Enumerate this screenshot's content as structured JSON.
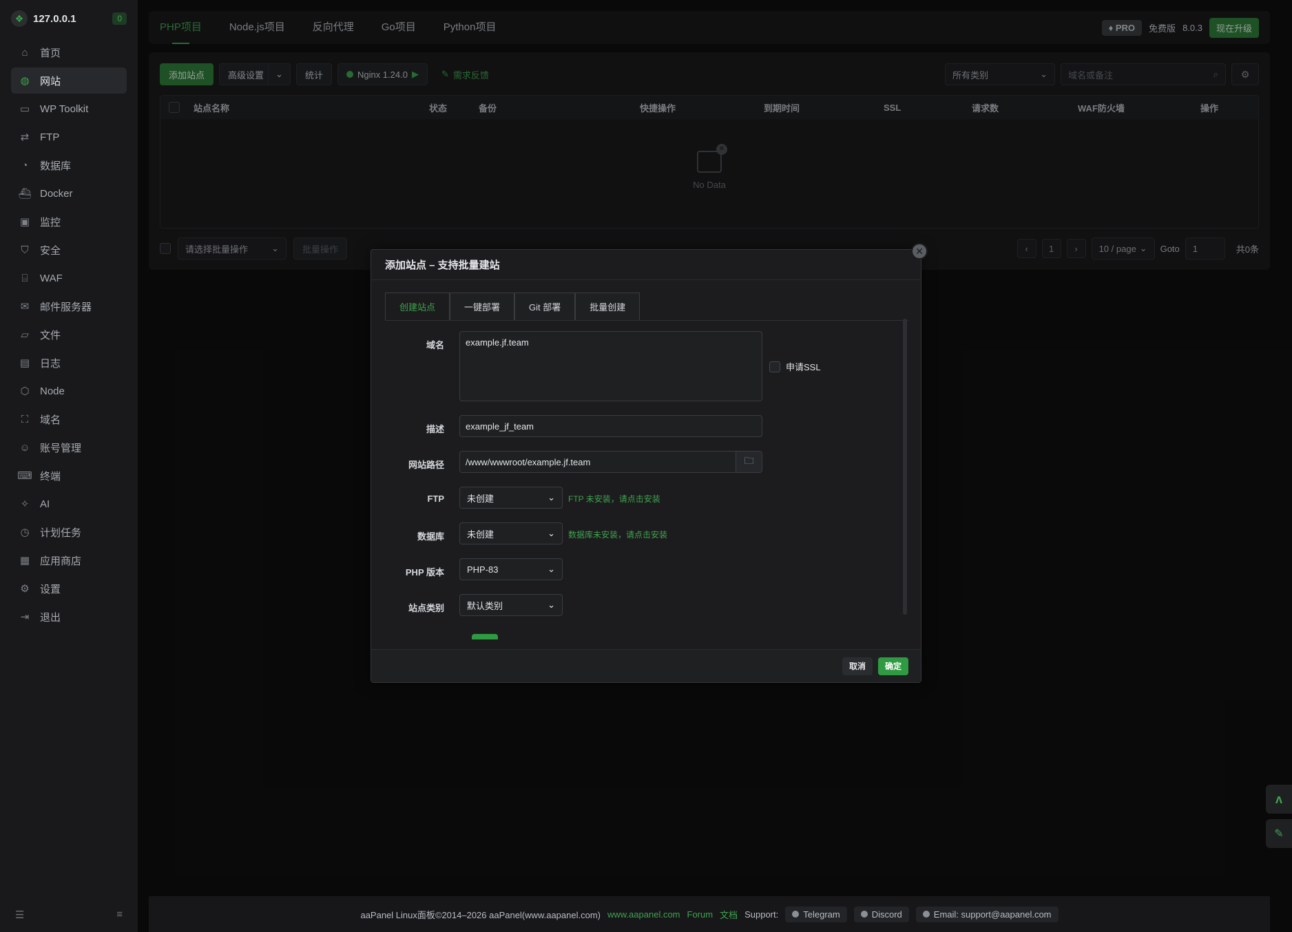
{
  "sidebar": {
    "host": "127.0.0.1",
    "badge": "0",
    "items": [
      {
        "label": "首页",
        "icon": "home-icon",
        "glyph": "⌂"
      },
      {
        "label": "网站",
        "icon": "globe-icon",
        "glyph": "◍"
      },
      {
        "label": "WP Toolkit",
        "icon": "wordpress-icon",
        "glyph": "▭"
      },
      {
        "label": "FTP",
        "icon": "transfer-icon",
        "glyph": "⇄"
      },
      {
        "label": "数据库",
        "icon": "database-icon",
        "glyph": "◔"
      },
      {
        "label": "Docker",
        "icon": "docker-icon",
        "glyph": "⛴"
      },
      {
        "label": "监控",
        "icon": "monitor-icon",
        "glyph": "▣"
      },
      {
        "label": "安全",
        "icon": "shield-icon",
        "glyph": "⛉"
      },
      {
        "label": "WAF",
        "icon": "firewall-icon",
        "glyph": "⌸"
      },
      {
        "label": "邮件服务器",
        "icon": "mail-icon",
        "glyph": "✉"
      },
      {
        "label": "文件",
        "icon": "folder-icon",
        "glyph": "▱"
      },
      {
        "label": "日志",
        "icon": "log-icon",
        "glyph": "▤"
      },
      {
        "label": "Node",
        "icon": "node-icon",
        "glyph": "⬡"
      },
      {
        "label": "域名",
        "icon": "domain-icon",
        "glyph": "⛶"
      },
      {
        "label": "账号管理",
        "icon": "user-icon",
        "glyph": "☺"
      },
      {
        "label": "终端",
        "icon": "terminal-icon",
        "glyph": "⌨"
      },
      {
        "label": "AI",
        "icon": "ai-sparkle-icon",
        "glyph": "✧"
      },
      {
        "label": "计划任务",
        "icon": "clock-icon",
        "glyph": "◷"
      },
      {
        "label": "应用商店",
        "icon": "store-icon",
        "glyph": "▦"
      },
      {
        "label": "设置",
        "icon": "settings-icon",
        "glyph": "⚙"
      },
      {
        "label": "退出",
        "icon": "logout-icon",
        "glyph": "⇥"
      }
    ],
    "active_index": 1
  },
  "topbar": {
    "tabs": [
      "PHP项目",
      "Node.js项目",
      "反向代理",
      "Go项目",
      "Python项目"
    ],
    "active_tab": 0,
    "pro_label": "PRO",
    "edition": "免费版",
    "version": "8.0.3",
    "upgrade_label": "现在升级"
  },
  "toolbar": {
    "add_site": "添加站点",
    "advanced": "高级设置",
    "stats": "统计",
    "nginx": "Nginx 1.24.0",
    "feedback": "需求反馈",
    "category_select": "所有类别",
    "search_placeholder": "域名或备注"
  },
  "table": {
    "columns": [
      "站点名称",
      "状态",
      "备份",
      "快捷操作",
      "到期时间",
      "SSL",
      "请求数",
      "WAF防火墙",
      "操作"
    ],
    "empty_text": "No Data"
  },
  "bottom": {
    "batch_select": "请选择批量操作",
    "batch_button": "批量操作",
    "page": "1",
    "page_size": "10 / page",
    "goto_label": "Goto",
    "goto_value": "1",
    "total": "共0条"
  },
  "modal": {
    "title": "添加站点 – 支持批量建站",
    "tabs": [
      "创建站点",
      "一键部署",
      "Git 部署",
      "批量创建"
    ],
    "active_tab": 0,
    "fields": {
      "domain_label": "域名",
      "domain_value": "example.jf.team",
      "ssl_label": "申请SSL",
      "desc_label": "描述",
      "desc_value": "example_jf_team",
      "path_label": "网站路径",
      "path_value": "/www/wwwroot/example.jf.team",
      "ftp_label": "FTP",
      "ftp_value": "未创建",
      "ftp_hint": "FTP 未安装，请点击安装",
      "db_label": "数据库",
      "db_value": "未创建",
      "db_hint": "数据库未安装，请点击安装",
      "php_label": "PHP 版本",
      "php_value": "PHP-83",
      "category_label": "站点类别",
      "category_value": "默认类别"
    },
    "cancel": "取消",
    "confirm": "确定"
  },
  "footer": {
    "copyright": "aaPanel Linux面板©2014–2026 aaPanel(www.aapanel.com)",
    "site_link": "www.aapanel.com",
    "forum": "Forum",
    "docs": "文档",
    "support_label": "Support:",
    "telegram": "Telegram",
    "discord": "Discord",
    "email": "Email: support@aapanel.com"
  },
  "colors": {
    "accent": "#3fa34d",
    "background": "#0f0f10",
    "sidebar": "#19191b"
  }
}
